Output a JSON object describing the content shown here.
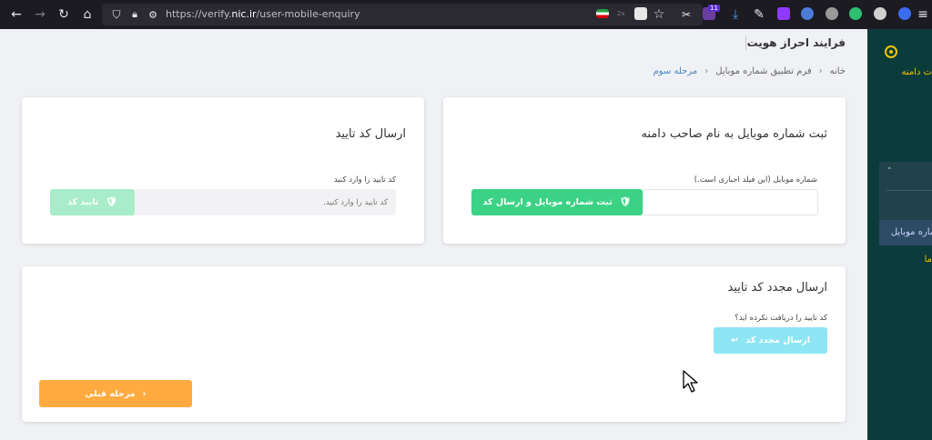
{
  "browser": {
    "url_prefix": "https://verify.",
    "url_domain": "nic.ir",
    "url_path": "/user-mobile-enquiry",
    "zoom_badge": "2x"
  },
  "header": {
    "title": "فرایند احراز هویت"
  },
  "breadcrumb": {
    "home": "خانه",
    "form": "فرم تطبیق شماره موبایل",
    "step": "مرحله سوم"
  },
  "register_card": {
    "title": "ثبت شماره موبایل به نام صاحب دامنه",
    "field_label": "شماره موبایل (این فیلد اجباری است.)",
    "mobile_value": "",
    "submit_label": "ثبت شماره موبایل و ارسال کد"
  },
  "verify_card": {
    "title": "ارسال کد تایید",
    "field_label": "کد تایید را وارد کنید",
    "code_placeholder": "کد تایید را وارد کنید.",
    "confirm_label": "تایید کد"
  },
  "resend_card": {
    "title": "ارسال مجدد کد تایید",
    "question": "کد تایید را دریافت نکرده اید؟",
    "resend_label": "ارسال مجدد کد",
    "prev_label": "مرحله قبلی"
  },
  "sidebar": {
    "top_label": "ت دامنه",
    "menu_item1": "ت",
    "menu_item2": "شماره موبایل",
    "bottom_label": "ما"
  },
  "colors": {
    "primary_green": "#3cd286",
    "orange": "#ffab40",
    "cyan": "#8ee5f3",
    "sidebar_bg": "#0c3b3c",
    "accent_yellow": "#f2c400"
  }
}
